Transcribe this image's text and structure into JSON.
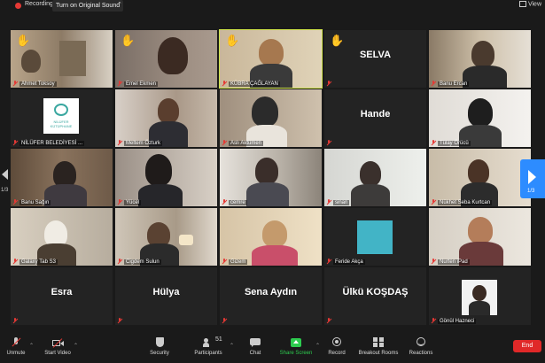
{
  "topbar": {
    "recording_label": "Recording",
    "original_sound_label": "Turn on Original Sound",
    "caret": "⌃",
    "view_label": "View"
  },
  "gallery": {
    "tiles": [
      {
        "name": "Ahmet Toksoy",
        "hand": "✋"
      },
      {
        "name": "Emel Ekmen",
        "hand": "✋"
      },
      {
        "name": "KÜBRA ÇAĞLAYAN",
        "hand": "✋"
      },
      {
        "big": "SELVA",
        "hand": "✋"
      },
      {
        "name": "Banu Ercan"
      },
      {
        "name": "NİLÜFER BELEDİYESİ ...",
        "logo": "NİLÜFER KÜTÜPHANE"
      },
      {
        "name": "Meltem Özturk"
      },
      {
        "name": "Aslı Aktümen"
      },
      {
        "big": "Hande"
      },
      {
        "name": "Tülay Örücü"
      },
      {
        "name": "Banu Sağın"
      },
      {
        "name": "Yücel"
      },
      {
        "name": "cemre"
      },
      {
        "name": "sinan"
      },
      {
        "name": "Nükhet Seba Kurtcan"
      },
      {
        "name": "Galaxy Tab S3"
      },
      {
        "name": "Cigdem Sulun"
      },
      {
        "name": "Gizem"
      },
      {
        "name": "Feride Akça"
      },
      {
        "name": "Nurten iPad"
      },
      {
        "big": "Esra"
      },
      {
        "big": "Hülya"
      },
      {
        "big": "Sena Aydın"
      },
      {
        "big": "Ülkü KOŞDAŞ"
      },
      {
        "name": "Gönül Hazneci"
      }
    ],
    "page_left": "1/3",
    "page_right": "1/3"
  },
  "toolbar": {
    "unmute": "Unmute",
    "start_video": "Start Video",
    "security": "Security",
    "participants": "Participants",
    "participants_count": "51",
    "chat": "Chat",
    "share_screen": "Share Screen",
    "record": "Record",
    "breakout_rooms": "Breakout Rooms",
    "reactions": "Reactions",
    "end": "End"
  },
  "colors": {
    "accent_blue": "#2d8cff",
    "end_red": "#e02828",
    "share_green": "#2dcc4f",
    "active_speaker": "#cfe34a",
    "hand_yellow": "#f6c342"
  }
}
